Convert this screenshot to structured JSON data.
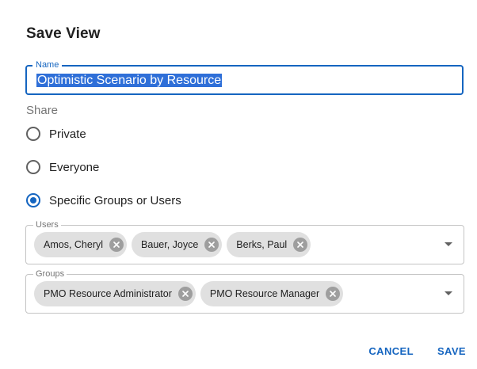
{
  "dialog": {
    "title": "Save View"
  },
  "name_field": {
    "legend": "Name",
    "value": "Optimistic Scenario by Resource"
  },
  "share": {
    "label": "Share",
    "options": [
      {
        "label": "Private",
        "checked": false
      },
      {
        "label": "Everyone",
        "checked": false
      },
      {
        "label": "Specific Groups or Users",
        "checked": true
      }
    ]
  },
  "users_field": {
    "legend": "Users",
    "chips": [
      "Amos, Cheryl",
      "Bauer, Joyce",
      "Berks, Paul"
    ]
  },
  "groups_field": {
    "legend": "Groups",
    "chips": [
      "PMO Resource Administrator",
      "PMO Resource Manager"
    ]
  },
  "actions": {
    "cancel_label": "CANCEL",
    "save_label": "SAVE"
  },
  "colors": {
    "accent": "#1565c0",
    "chip_bg": "#e0e0e0",
    "chip_remove": "#9e9e9e"
  },
  "icons": {
    "chip_remove": "cancel-circle-icon",
    "dropdown": "arrow-drop-down-icon"
  }
}
